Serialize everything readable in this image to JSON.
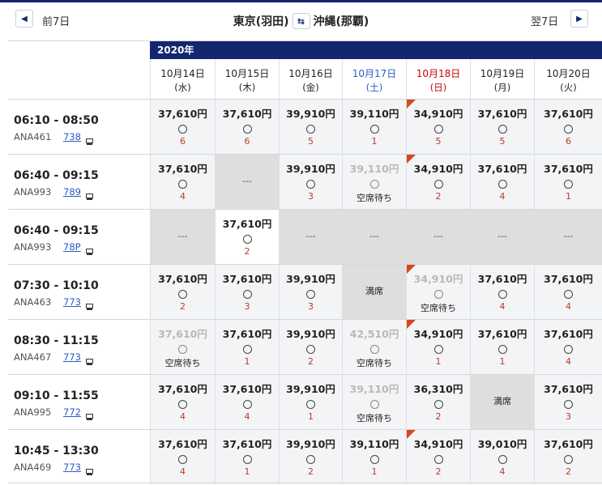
{
  "nav": {
    "prev_label": "前7日",
    "next_label": "翌7日",
    "prev_icon": "chevron-left-icon",
    "next_icon": "chevron-right-icon"
  },
  "route": {
    "origin": "東京(羽田)",
    "destination": "沖縄(那覇)",
    "swap_icon": "swap-arrows-icon"
  },
  "year_label": "2020年",
  "colors": {
    "header_navy": "#13276e",
    "seats_red": "#c0392b",
    "saturday_blue": "#2c5bc6",
    "sunday_red": "#d00000",
    "corner_flag": "#d9461c"
  },
  "dates": [
    {
      "date": "10月14日",
      "dow": "(水)",
      "type": "weekday"
    },
    {
      "date": "10月15日",
      "dow": "(木)",
      "type": "weekday"
    },
    {
      "date": "10月16日",
      "dow": "(金)",
      "type": "weekday"
    },
    {
      "date": "10月17日",
      "dow": "(土)",
      "type": "sat"
    },
    {
      "date": "10月18日",
      "dow": "(日)",
      "type": "sun"
    },
    {
      "date": "10月19日",
      "dow": "(月)",
      "type": "weekday"
    },
    {
      "date": "10月20日",
      "dow": "(火)",
      "type": "weekday"
    }
  ],
  "flights": [
    {
      "time": "06:10 - 08:50",
      "number": "ANA461",
      "aircraft": "738",
      "cells": [
        {
          "kind": "price",
          "price": "37,610円",
          "mark": "○",
          "seats": "6"
        },
        {
          "kind": "price",
          "price": "37,610円",
          "mark": "○",
          "seats": "6"
        },
        {
          "kind": "price",
          "price": "39,910円",
          "mark": "○",
          "seats": "5"
        },
        {
          "kind": "price",
          "price": "39,110円",
          "mark": "○",
          "seats": "1"
        },
        {
          "kind": "price",
          "price": "34,910円",
          "mark": "○",
          "seats": "5",
          "flag": true
        },
        {
          "kind": "price",
          "price": "37,610円",
          "mark": "○",
          "seats": "5"
        },
        {
          "kind": "price",
          "price": "37,610円",
          "mark": "○",
          "seats": "6"
        }
      ]
    },
    {
      "time": "06:40 - 09:15",
      "number": "ANA993",
      "aircraft": "789",
      "cells": [
        {
          "kind": "price",
          "price": "37,610円",
          "mark": "○",
          "seats": "4"
        },
        {
          "kind": "none",
          "text": "---"
        },
        {
          "kind": "price",
          "price": "39,910円",
          "mark": "○",
          "seats": "3"
        },
        {
          "kind": "wait",
          "price": "39,110円",
          "mark": "○",
          "status": "空席待ち"
        },
        {
          "kind": "price",
          "price": "34,910円",
          "mark": "○",
          "seats": "2",
          "flag": true
        },
        {
          "kind": "price",
          "price": "37,610円",
          "mark": "○",
          "seats": "4"
        },
        {
          "kind": "price",
          "price": "37,610円",
          "mark": "○",
          "seats": "1"
        }
      ]
    },
    {
      "time": "06:40 - 09:15",
      "number": "ANA993",
      "aircraft": "78P",
      "cells": [
        {
          "kind": "none",
          "text": "---"
        },
        {
          "kind": "price",
          "price": "37,610円",
          "mark": "○",
          "seats": "2",
          "white": true
        },
        {
          "kind": "none",
          "text": "---"
        },
        {
          "kind": "none",
          "text": "---"
        },
        {
          "kind": "none",
          "text": "---"
        },
        {
          "kind": "none",
          "text": "---"
        },
        {
          "kind": "none",
          "text": "---"
        }
      ]
    },
    {
      "time": "07:30 - 10:10",
      "number": "ANA463",
      "aircraft": "773",
      "cells": [
        {
          "kind": "price",
          "price": "37,610円",
          "mark": "○",
          "seats": "2"
        },
        {
          "kind": "price",
          "price": "37,610円",
          "mark": "○",
          "seats": "3"
        },
        {
          "kind": "price",
          "price": "39,910円",
          "mark": "○",
          "seats": "3"
        },
        {
          "kind": "full",
          "text": "満席"
        },
        {
          "kind": "wait",
          "price": "34,910円",
          "mark": "○",
          "status": "空席待ち",
          "flag": true
        },
        {
          "kind": "price",
          "price": "37,610円",
          "mark": "○",
          "seats": "4"
        },
        {
          "kind": "price",
          "price": "37,610円",
          "mark": "○",
          "seats": "4"
        }
      ]
    },
    {
      "time": "08:30 - 11:15",
      "number": "ANA467",
      "aircraft": "773",
      "cells": [
        {
          "kind": "wait",
          "price": "37,610円",
          "mark": "○",
          "status": "空席待ち"
        },
        {
          "kind": "price",
          "price": "37,610円",
          "mark": "○",
          "seats": "1"
        },
        {
          "kind": "price",
          "price": "39,910円",
          "mark": "○",
          "seats": "2"
        },
        {
          "kind": "wait",
          "price": "42,510円",
          "mark": "○",
          "status": "空席待ち"
        },
        {
          "kind": "price",
          "price": "34,910円",
          "mark": "○",
          "seats": "1",
          "flag": true
        },
        {
          "kind": "price",
          "price": "37,610円",
          "mark": "○",
          "seats": "1"
        },
        {
          "kind": "price",
          "price": "37,610円",
          "mark": "○",
          "seats": "4"
        }
      ]
    },
    {
      "time": "09:10 - 11:55",
      "number": "ANA995",
      "aircraft": "772",
      "cells": [
        {
          "kind": "price",
          "price": "37,610円",
          "mark": "○",
          "seats": "4"
        },
        {
          "kind": "price",
          "price": "37,610円",
          "mark": "○",
          "seats": "4"
        },
        {
          "kind": "price",
          "price": "39,910円",
          "mark": "○",
          "seats": "1"
        },
        {
          "kind": "wait",
          "price": "39,110円",
          "mark": "○",
          "status": "空席待ち"
        },
        {
          "kind": "price",
          "price": "36,310円",
          "mark": "○",
          "seats": "2"
        },
        {
          "kind": "full",
          "text": "満席"
        },
        {
          "kind": "price",
          "price": "37,610円",
          "mark": "○",
          "seats": "3"
        }
      ]
    },
    {
      "time": "10:45 - 13:30",
      "number": "ANA469",
      "aircraft": "773",
      "cells": [
        {
          "kind": "price",
          "price": "37,610円",
          "mark": "○",
          "seats": "4"
        },
        {
          "kind": "price",
          "price": "37,610円",
          "mark": "○",
          "seats": "1"
        },
        {
          "kind": "price",
          "price": "39,910円",
          "mark": "○",
          "seats": "2"
        },
        {
          "kind": "price",
          "price": "39,110円",
          "mark": "○",
          "seats": "1"
        },
        {
          "kind": "price",
          "price": "34,910円",
          "mark": "○",
          "seats": "2",
          "flag": true
        },
        {
          "kind": "price",
          "price": "39,010円",
          "mark": "○",
          "seats": "4"
        },
        {
          "kind": "price",
          "price": "37,610円",
          "mark": "○",
          "seats": "2"
        }
      ]
    }
  ]
}
